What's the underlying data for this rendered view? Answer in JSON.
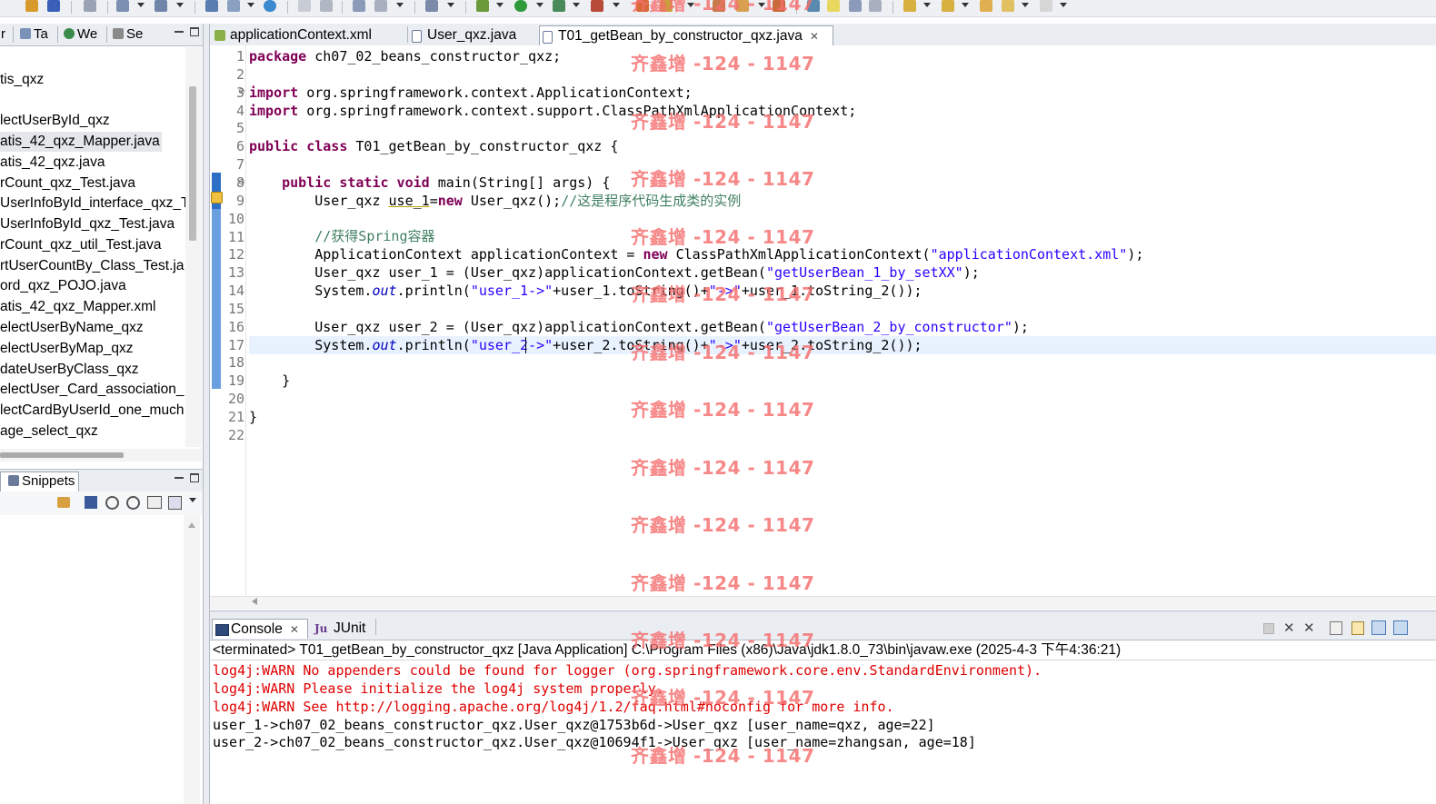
{
  "left_panel": {
    "tabs": [
      {
        "label": "r"
      },
      {
        "label": "Ta"
      },
      {
        "label": "We"
      },
      {
        "label": "Se"
      }
    ],
    "tree_items": [
      {
        "label": "tis_qxz"
      },
      {
        "label": ""
      },
      {
        "label": "lectUserById_qxz"
      },
      {
        "label": "atis_42_qxz_Mapper.java",
        "selected": true
      },
      {
        "label": "atis_42_qxz.java"
      },
      {
        "label": "rCount_qxz_Test.java"
      },
      {
        "label": "UserInfoById_interface_qxz_T"
      },
      {
        "label": "UserInfoById_qxz_Test.java"
      },
      {
        "label": "rCount_qxz_util_Test.java"
      },
      {
        "label": "rtUserCountBy_Class_Test.ja"
      },
      {
        "label": "ord_qxz_POJO.java"
      },
      {
        "label": "atis_42_qxz_Mapper.xml"
      },
      {
        "label": "electUserByName_qxz"
      },
      {
        "label": "electUserByMap_qxz"
      },
      {
        "label": "dateUserByClass_qxz"
      },
      {
        "label": "electUser_Card_association_"
      },
      {
        "label": "lectCardByUserId_one_much"
      },
      {
        "label": "age_select_qxz"
      }
    ]
  },
  "snippets_panel": {
    "tab_label": "Snippets"
  },
  "editor": {
    "tabs": [
      {
        "label": "applicationContext.xml"
      },
      {
        "label": "User_qxz.java"
      },
      {
        "label": "T01_getBean_by_constructor_qxz.java",
        "active": true
      }
    ],
    "line_numbers": [
      "1",
      "2",
      "3",
      "4",
      "5",
      "6",
      "7",
      "8",
      "9",
      "10",
      "11",
      "12",
      "13",
      "14",
      "15",
      "16",
      "17",
      "18",
      "19",
      "20",
      "21",
      "22"
    ],
    "code": {
      "l1_kw": "package",
      "l1_rest": " ch07_02_beans_constructor_qxz;",
      "l3_kw": "import",
      "l3_rest": " org.springframework.context.ApplicationContext;",
      "l4_kw": "import",
      "l4_rest": " org.springframework.context.support.ClassPathXmlApplicationContext;",
      "l6_kw": "public class",
      "l6_rest": " T01_getBean_by_constructor_qxz {",
      "l8_indent": "    ",
      "l8_kw": "public static void",
      "l8_rest": " main(String[] args) {",
      "l9_a": "        User_qxz ",
      "l9_var": "use_1",
      "l9_b": "=",
      "l9_kw": "new",
      "l9_c": " User_qxz();",
      "l9_cmt": "//这是程序代码生成类的实例",
      "l11_indent": "        ",
      "l11_cmt": "//获得Spring容器",
      "l12_a": "        ApplicationContext applicationContext = ",
      "l12_kw": "new",
      "l12_b": " ClassPathXmlApplicationContext(",
      "l12_str": "\"applicationContext.xml\"",
      "l12_c": ");",
      "l13_a": "        User_qxz user_1 = (User_qxz)applicationContext.getBean(",
      "l13_str": "\"getUserBean_1_by_setXX\"",
      "l13_c": ");",
      "l14_a": "        System.",
      "l14_fld": "out",
      "l14_b": ".println(",
      "l14_str1": "\"user_1->\"",
      "l14_c": "+user_1.toString()+",
      "l14_str2": "\"->\"",
      "l14_d": "+user_1.toString_2());",
      "l16_a": "        User_qxz user_2 = (User_qxz)applicationContext.getBean(",
      "l16_str": "\"getUserBean_2_by_constructor\"",
      "l16_c": ");",
      "l17_a": "        System.",
      "l17_fld": "out",
      "l17_b": ".println(",
      "l17_str1": "\"user_2->\"",
      "l17_c": "+user_2.toString()+",
      "l17_str2": "\"->\"",
      "l17_d": "+user_2.toString_2());",
      "l19": "    }",
      "l21": "}"
    }
  },
  "console": {
    "tabs": [
      {
        "label": "Console"
      },
      {
        "label": "JUnit"
      }
    ],
    "junit_icon_text": "Ju",
    "header": "<terminated> T01_getBean_by_constructor_qxz [Java Application] C:\\Program Files (x86)\\Java\\jdk1.8.0_73\\bin\\javaw.exe (2025-4-3 下午4:36:21)",
    "lines": [
      {
        "text": "log4j:WARN No appenders could be found for logger (org.springframework.core.env.StandardEnvironment).",
        "kind": "err"
      },
      {
        "text": "log4j:WARN Please initialize the log4j system properly.",
        "kind": "err"
      },
      {
        "text": "log4j:WARN See http://logging.apache.org/log4j/1.2/faq.html#noconfig for more info.",
        "kind": "err"
      },
      {
        "text": "user_1->ch07_02_beans_constructor_qxz.User_qxz@1753b6d->User_qxz [user_name=qxz, age=22]",
        "kind": "out"
      },
      {
        "text": "user_2->ch07_02_beans_constructor_qxz.User_qxz@10694f1->User_qxz [user_name=zhangsan, age=18]",
        "kind": "out"
      }
    ]
  },
  "watermark": {
    "text": "齐鑫增 -124 - 1147"
  },
  "colors": {
    "keyword": "#7f0055",
    "string": "#2a00ff",
    "comment": "#3f7f5f",
    "field": "#0000c0",
    "stderr": "#e00000",
    "watermark": "#f56e6e",
    "change_bar": "#2c6fc5"
  }
}
